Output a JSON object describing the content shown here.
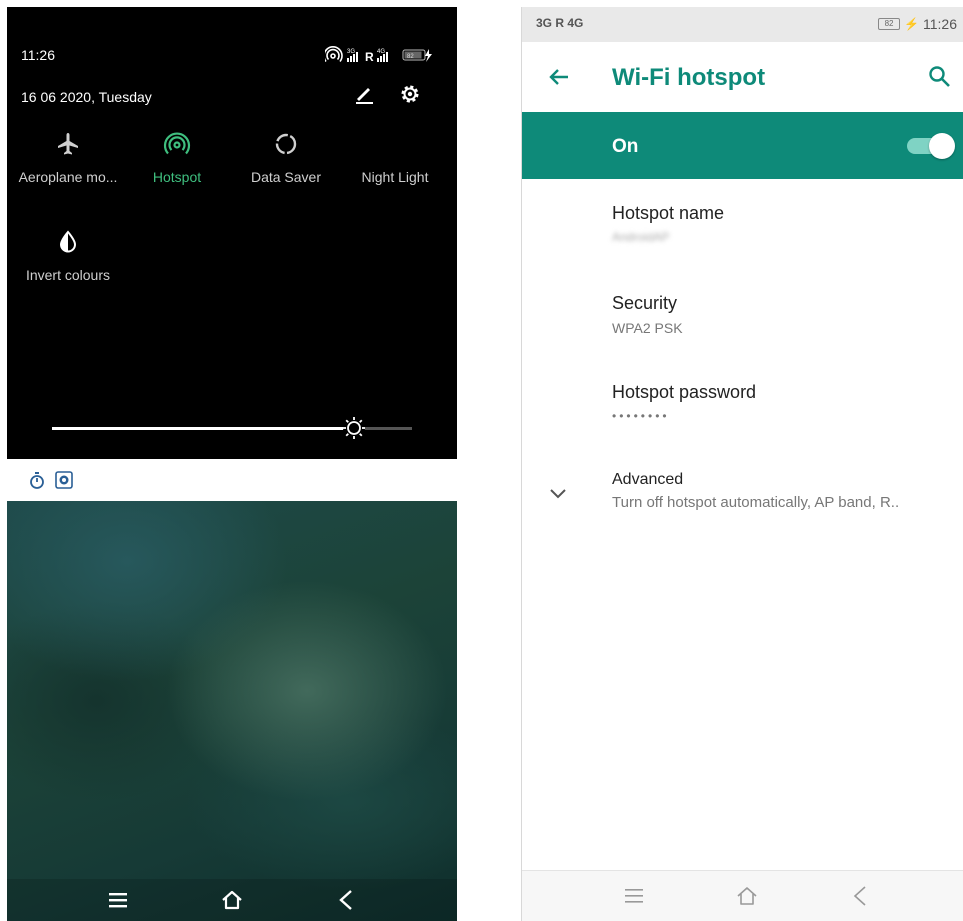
{
  "left_phone": {
    "status": {
      "time": "11:26",
      "date": "16 06 2020, Tuesday",
      "icons": [
        "hotspot-icon",
        "signal-3g-icon",
        "roaming-icon",
        "signal-4g-icon",
        "battery-icon"
      ],
      "battery_level": "82"
    },
    "header_actions": [
      "edit-icon",
      "settings-icon"
    ],
    "tiles": [
      {
        "label": "Aeroplane mo...",
        "icon": "airplane-icon",
        "active": false
      },
      {
        "label": "Hotspot",
        "icon": "hotspot-icon",
        "active": true
      },
      {
        "label": "Data Saver",
        "icon": "data-saver-icon",
        "active": false
      },
      {
        "label": "Night Light",
        "icon": "night-light-icon",
        "active": false
      },
      {
        "label": "Invert colours",
        "icon": "invert-colours-icon",
        "active": false
      }
    ],
    "brightness": {
      "level": 0.84,
      "icon": "brightness-icon"
    },
    "mini_icons": [
      "timer-icon",
      "screen-record-icon"
    ],
    "nav": [
      "menu-icon",
      "home-icon",
      "back-icon"
    ]
  },
  "right_phone": {
    "status": {
      "left": "3G R 4G",
      "battery_level": "82",
      "time": "11:26"
    },
    "appbar": {
      "title": "Wi-Fi hotspot",
      "back_icon": "arrow-left-icon",
      "search_icon": "search-icon"
    },
    "master_switch": {
      "label": "On",
      "state": true
    },
    "settings": [
      {
        "title": "Hotspot name",
        "subtitle": "AndroidAP"
      },
      {
        "title": "Security",
        "subtitle": "WPA2 PSK"
      },
      {
        "title": "Hotspot password",
        "subtitle": "••••••••"
      },
      {
        "title": "Advanced",
        "subtitle": "Turn off hotspot automatically, AP band, R.."
      }
    ],
    "nav": [
      "menu-icon",
      "home-icon",
      "back-icon"
    ]
  },
  "colors": {
    "accent": "#0e8a79",
    "hotspot_active": "#3fbf7f",
    "qs_background": "#000000"
  }
}
